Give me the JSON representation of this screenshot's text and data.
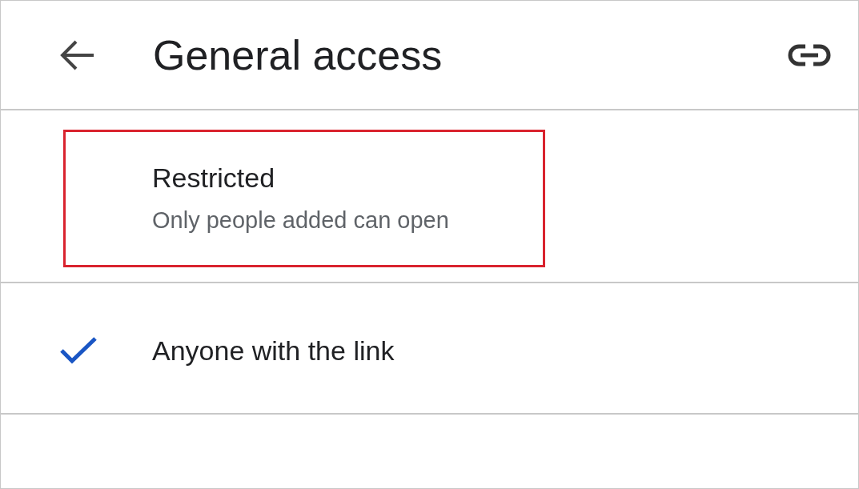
{
  "header": {
    "title": "General access"
  },
  "options": [
    {
      "label": "Restricted",
      "description": "Only people added can open",
      "selected": false,
      "highlighted": true
    },
    {
      "label": "Anyone with the link",
      "selected": true,
      "highlighted": false
    }
  ]
}
